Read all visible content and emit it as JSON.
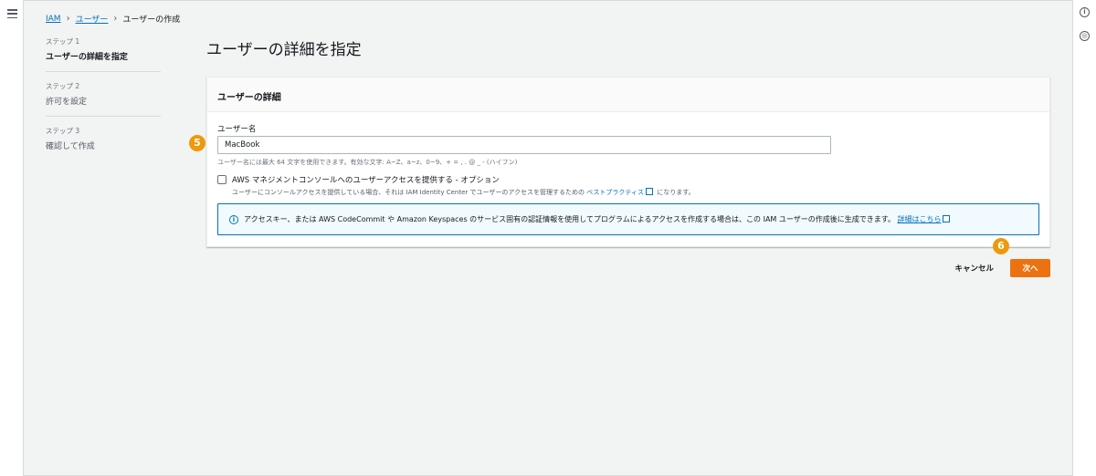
{
  "breadcrumb": {
    "iam": "IAM",
    "users": "ユーザー",
    "current": "ユーザーの作成"
  },
  "steps": [
    {
      "num": "ステップ 1",
      "label": "ユーザーの詳細を指定",
      "active": true
    },
    {
      "num": "ステップ 2",
      "label": "許可を設定",
      "active": false
    },
    {
      "num": "ステップ 3",
      "label": "確認して作成",
      "active": false
    }
  ],
  "page_title": "ユーザーの詳細を指定",
  "panel": {
    "header": "ユーザーの詳細",
    "username_label": "ユーザー名",
    "username_value": "MacBook",
    "username_help": "ユーザー名には最大 64 文字を使用できます。有効な文字: A~Z、a~z、0~9、+ = , . @ _ - (ハイフン)",
    "console_access_label": "AWS マネジメントコンソールへのユーザーアクセスを提供する - オプション",
    "console_access_checked": false,
    "console_desc_prefix": "ユーザーにコンソールアクセスを提供している場合、それは IAM Identity Center でユーザーのアクセスを管理するための",
    "console_desc_link": "ベストプラクティス",
    "console_desc_suffix": "になります。",
    "info_text": "アクセスキー、または AWS CodeCommit や Amazon Keyspaces のサービス固有の認証情報を使用してプログラムによるアクセスを作成する場合は、この IAM ユーザーの作成後に生成できます。",
    "info_link": "詳細はこちら"
  },
  "actions": {
    "cancel": "キャンセル",
    "next": "次へ"
  },
  "annotations": {
    "badge_5": "5",
    "badge_6": "6"
  },
  "colors": {
    "primary_button": "#ec7211",
    "link": "#0073bb",
    "badge": "#ec9a0b",
    "background": "#f2f3f3"
  },
  "icons": [
    "menu-icon",
    "info-icon",
    "settings-icon",
    "external-link-icon"
  ]
}
